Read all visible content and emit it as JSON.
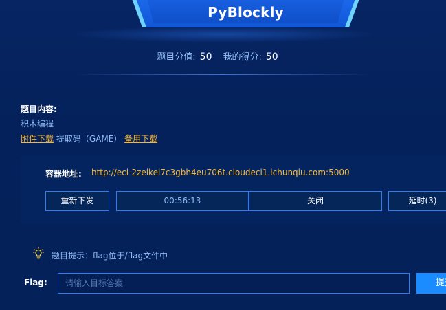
{
  "header": {
    "title": "PyBlockly"
  },
  "score": {
    "total_label": "题目分值:",
    "total_value": "50",
    "mine_label": "我的得分:",
    "mine_value": "50"
  },
  "challenge": {
    "content_label": "题目内容:",
    "content_text": "积木编程",
    "attachment_link": "附件下载",
    "extract_code": "提取码（GAME）",
    "backup_link": "备用下载"
  },
  "container": {
    "address_label": "容器地址:",
    "address_url": "http://eci-2zeikei7c3gbh4eu706t.cloudeci1.ichunqiu.com:5000",
    "redeploy_label": "重新下发",
    "timer": "00:56:13",
    "close_label": "关闭",
    "extend_label": "延时(3)"
  },
  "hint": {
    "icon": "lightbulb-icon",
    "text": "题目提示：flag位于/flag文件中"
  },
  "flag": {
    "label": "Flag:",
    "placeholder": "请输入目标答案",
    "value": "",
    "submit_label": "提交"
  },
  "colors": {
    "background": "#04215b",
    "accent": "#1a8cff",
    "link": "#f7b731",
    "muted_text": "#8fbaf5",
    "border": "#2f7df0"
  }
}
